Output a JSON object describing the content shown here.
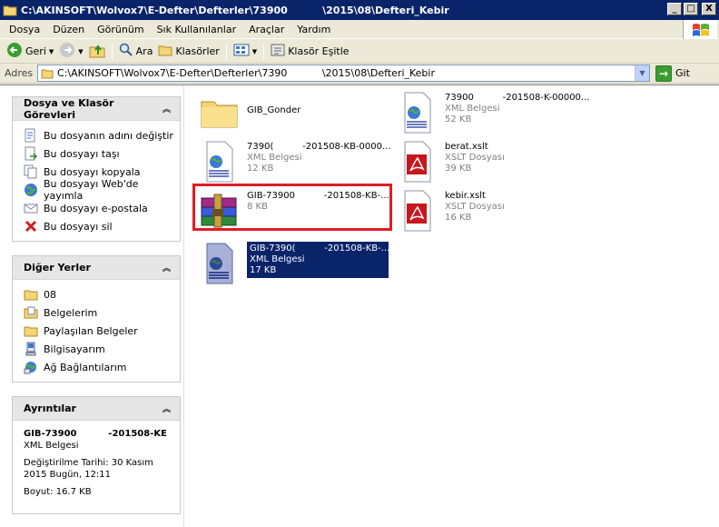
{
  "window": {
    "title": "C:\\AKINSOFT\\Wolvox7\\E-Defter\\Defterler\\73900          \\2015\\08\\Defteri_Kebir",
    "controls": {
      "minimize": "_",
      "maximize": "□",
      "close": "X"
    }
  },
  "menu": [
    "Dosya",
    "Düzen",
    "Görünüm",
    "Sık Kullanılanlar",
    "Araçlar",
    "Yardım"
  ],
  "toolbar": {
    "back": "Geri",
    "search": "Ara",
    "folders": "Klasörler",
    "sync": "Klasör Eşitle"
  },
  "address": {
    "label": "Adres",
    "path": "C:\\AKINSOFT\\Wolvox7\\E-Defter\\Defterler\\7390           \\2015\\08\\Defteri_Kebir",
    "go": "Git"
  },
  "tasks_panel": {
    "title": "Dosya ve Klasör Görevleri",
    "items": [
      {
        "label": "Bu dosyanın adını değiştir",
        "icon": "rename-icon"
      },
      {
        "label": "Bu dosyayı taşı",
        "icon": "move-icon"
      },
      {
        "label": "Bu dosyayı kopyala",
        "icon": "copy-icon"
      },
      {
        "label": "Bu dosyayı Web'de yayımla",
        "icon": "publish-web-icon"
      },
      {
        "label": "Bu dosyayı e-postala",
        "icon": "email-icon"
      },
      {
        "label": "Bu dosyayı sil",
        "icon": "delete-icon"
      }
    ]
  },
  "places_panel": {
    "title": "Diğer Yerler",
    "items": [
      {
        "label": "08",
        "icon": "folder-icon"
      },
      {
        "label": "Belgelerim",
        "icon": "documents-icon"
      },
      {
        "label": "Paylaşılan Belgeler",
        "icon": "shared-folder-icon"
      },
      {
        "label": "Bilgisayarım",
        "icon": "computer-icon"
      },
      {
        "label": "Ağ Bağlantılarım",
        "icon": "network-icon"
      }
    ]
  },
  "details_panel": {
    "title": "Ayrıntılar",
    "name": "GIB-73900          -201508-KE",
    "type": "XML Belgesi",
    "modified": "Değiştirilme Tarihi: 30 Kasım 2015 Bugün, 12:11",
    "size": "Boyut: 16.7 KB"
  },
  "files": [
    {
      "name": "GIB_Gonder",
      "type": "",
      "size": "",
      "icon": "folder-icon"
    },
    {
      "name": "73900          -201508-K-00000...",
      "type": "XML Belgesi",
      "size": "52 KB",
      "icon": "xml-document-icon"
    },
    {
      "name": "7390(          -201508-KB-0000...",
      "type": "XML Belgesi",
      "size": "12 KB",
      "icon": "xml-document-icon"
    },
    {
      "name": "berat.xslt",
      "type": "XSLT Dosyası",
      "size": "39 KB",
      "icon": "xslt-file-icon"
    },
    {
      "name": "GIB-73900          -201508-KB-...",
      "type": "",
      "size": "8 KB",
      "icon": "winrar-archive-icon"
    },
    {
      "name": "kebir.xslt",
      "type": "XSLT Dosyası",
      "size": "16 KB",
      "icon": "xslt-file-icon"
    },
    {
      "name": "GIB-7390(          -201508-KB-...",
      "type": "XML Belgesi",
      "size": "17 KB",
      "icon": "xml-document-icon"
    }
  ],
  "colors": {
    "titlebar": "#0a246a",
    "highlight_box": "#e01c24",
    "selection": "#0a246a"
  }
}
